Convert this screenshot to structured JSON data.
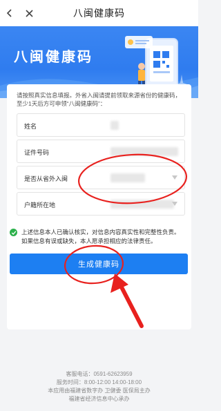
{
  "nav": {
    "title": "八闽健康码",
    "back_icon": "chevron-left-icon",
    "close_icon": "close-icon"
  },
  "banner": {
    "title": "八闽健康码"
  },
  "form": {
    "notice": "请按照真实信息填报。外省入闽请提前领取来源省份的健康码，至少1天后方可申领“八闽健康码”：",
    "fields": [
      {
        "label": "姓名",
        "value": ""
      },
      {
        "label": "证件号码",
        "value": ""
      },
      {
        "label": "是否从省外入闽",
        "value": ""
      },
      {
        "label": "户籍所在地",
        "value": ""
      }
    ],
    "consent": "上述信息本人已确认核实，对信息内容真实性和完整性负责。如果信息有误或缺失，本人愿承担相应的法律责任。",
    "submit_label": "生成健康码"
  },
  "footer": {
    "hotline": "客服电话：0591-62623959",
    "hours": "服务时间：8:00-12:00 14:00-18:00",
    "provider": "本应用由福建省数字办 卫健委 医保局主办",
    "operator": "福建省经济信息中心承办"
  },
  "colors": {
    "primary": "#1d7ff2",
    "banner": "#2f7cef",
    "check": "#2db14c",
    "annotation": "#e8211e"
  }
}
